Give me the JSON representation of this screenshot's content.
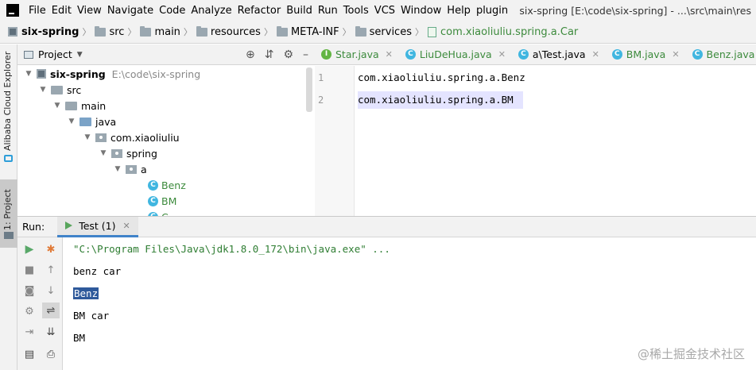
{
  "menubar": {
    "items": [
      "File",
      "Edit",
      "View",
      "Navigate",
      "Code",
      "Analyze",
      "Refactor",
      "Build",
      "Run",
      "Tools",
      "VCS",
      "Window",
      "Help",
      "plugin"
    ],
    "title": "six-spring [E:\\code\\six-spring] - ...\\src\\main\\res"
  },
  "breadcrumbs": [
    "six-spring",
    "src",
    "main",
    "resources",
    "META-INF",
    "services",
    "com.xiaoliuliu.spring.a.Car"
  ],
  "left_strip": {
    "top_label": "Alibaba Cloud Explorer",
    "bottom_label": "1: Project"
  },
  "project_panel": {
    "title": "Project",
    "tree": [
      {
        "label": "six-spring",
        "extra": "E:\\code\\six-spring"
      },
      {
        "label": "src"
      },
      {
        "label": "main"
      },
      {
        "label": "java"
      },
      {
        "label": "com.xiaoliuliu"
      },
      {
        "label": "spring"
      },
      {
        "label": "a"
      },
      {
        "label": "Benz"
      },
      {
        "label": "BM"
      },
      {
        "label": "C"
      }
    ]
  },
  "editor": {
    "tabs": [
      "Star.java",
      "LiuDeHua.java",
      "a\\Test.java",
      "BM.java",
      "Benz.java"
    ],
    "lines": [
      {
        "num": "1",
        "text": "com.xiaoliuliu.spring.a.Benz"
      },
      {
        "num": "2",
        "text": "com.xiaoliuliu.spring.a.BM"
      }
    ]
  },
  "run_panel": {
    "label": "Run:",
    "tab": "Test (1)",
    "console": [
      "\"C:\\Program Files\\Java\\jdk1.8.0_172\\bin\\java.exe\" ...",
      "benz car",
      "Benz",
      "BM car",
      "BM"
    ]
  },
  "watermark": "@稀土掘金技术社区"
}
